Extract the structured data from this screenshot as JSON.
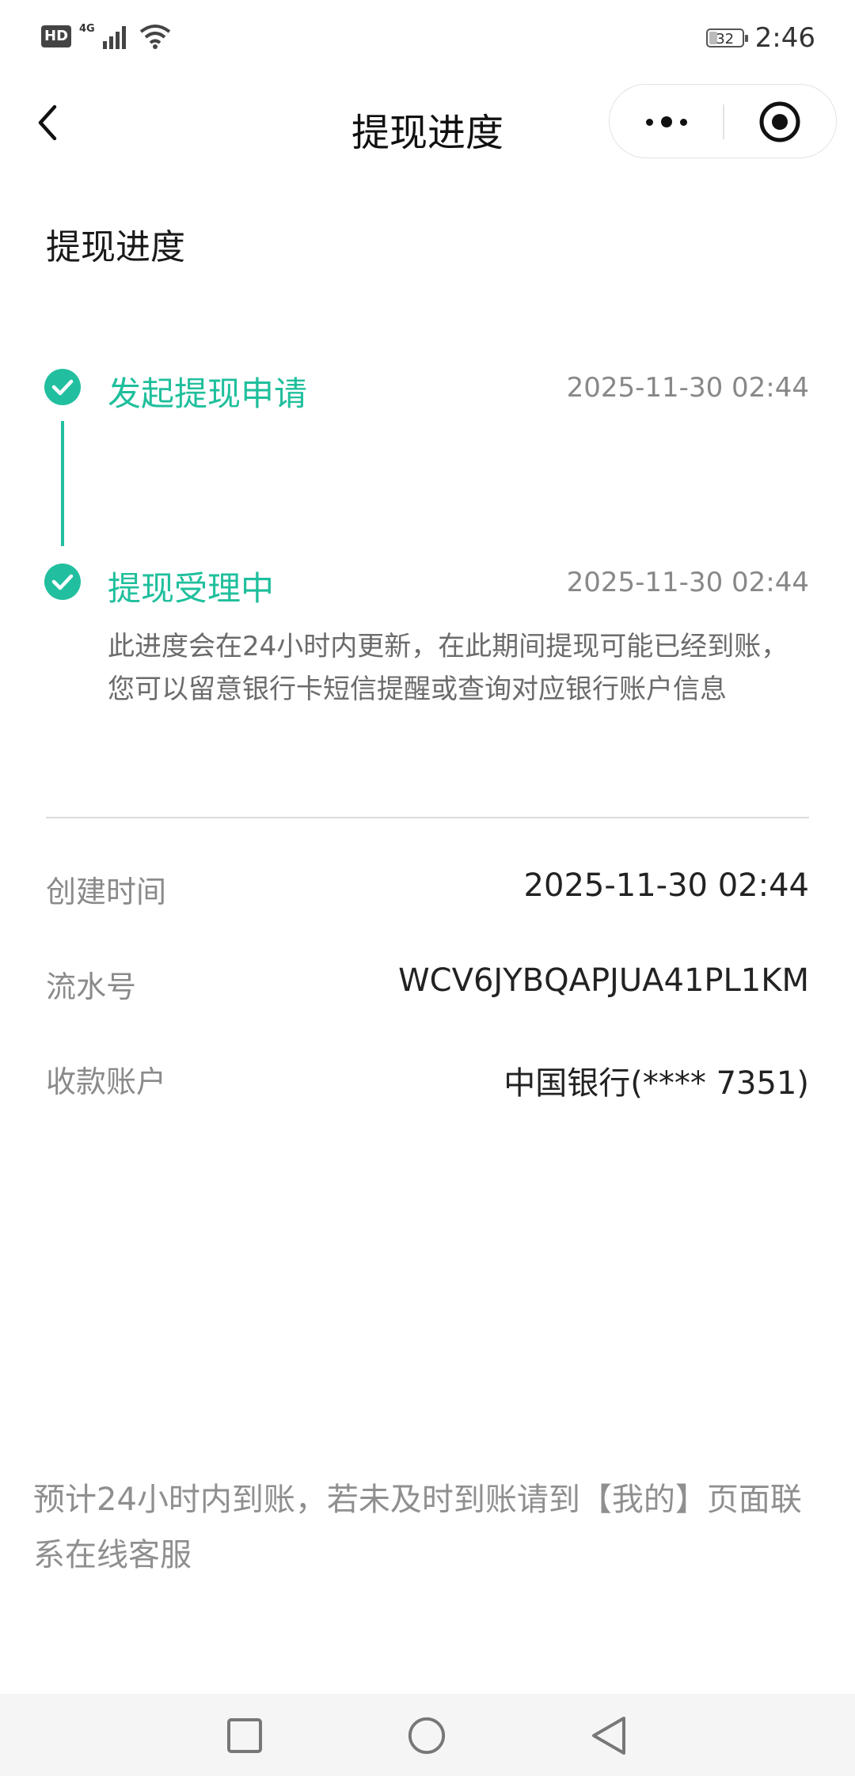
{
  "status_bar": {
    "left_badge": "HD",
    "network": "4G",
    "time": "2:46",
    "battery": "32"
  },
  "nav": {
    "title": "提现进度"
  },
  "section": {
    "title": "提现进度"
  },
  "progress": {
    "accent_color": "#21bfa0",
    "steps": [
      {
        "label": "发起提现申请",
        "time": "2025-11-30 02:44"
      },
      {
        "label": "提现受理中",
        "time": "2025-11-30 02:44",
        "description": "此进度会在24小时内更新，在此期间提现可能已经到账，您可以留意银行卡短信提醒或查询对应银行账户信息"
      }
    ]
  },
  "details": [
    {
      "label": "创建时间",
      "value": "2025-11-30 02:44"
    },
    {
      "label": "流水号",
      "value": "WCV6JYBQAPJUA41PL1KM"
    },
    {
      "label": "收款账户",
      "value": "中国银行(**** 7351)"
    }
  ],
  "footer_note": "预计24小时内到账，若未及时到账请到【我的】页面联系在线客服",
  "icons": {
    "back": "chevron-left-icon",
    "more": "more-dots-icon",
    "close": "target-close-icon",
    "check": "check-circle-icon",
    "home": "square-icon",
    "recents": "circle-icon",
    "sys_back": "triangle-back-icon"
  }
}
